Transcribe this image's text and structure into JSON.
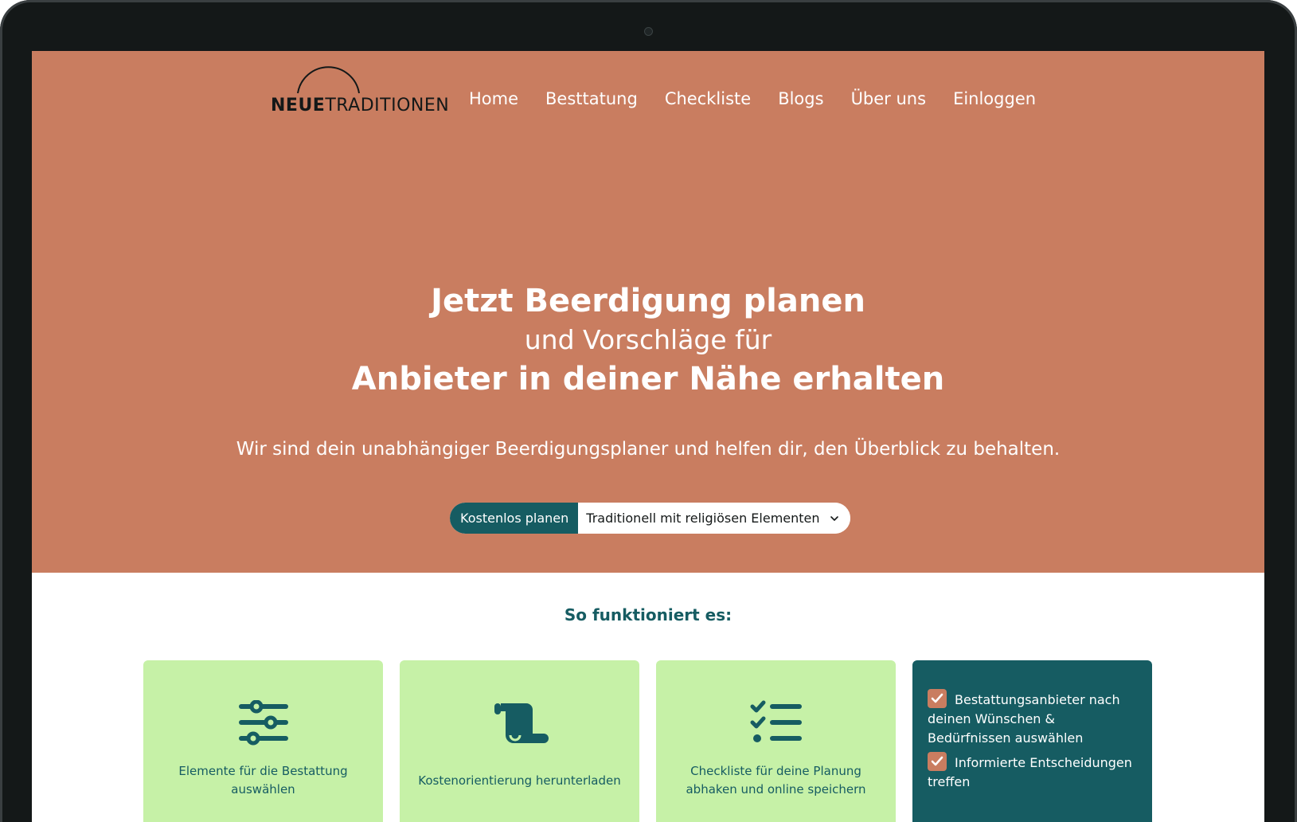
{
  "brand": {
    "name_bold": "NEUE",
    "name_regular": "TRADITIONEN"
  },
  "nav": {
    "items": [
      "Home",
      "Besttatung",
      "Checkliste",
      "Blogs",
      "Über uns",
      "Einloggen"
    ]
  },
  "hero": {
    "line1": "Jetzt Beerdigung planen",
    "line2": "und Vorschläge für",
    "line3": "Anbieter in deiner Nähe erhalten",
    "subline": "Wir sind dein unabhängiger Beerdigungsplaner und helfen dir, den Überblick zu behalten.",
    "cta_label": "Kostenlos planen",
    "select_value": "Traditionell mit religiösen Elementen"
  },
  "how": {
    "title": "So funktioniert es:",
    "cards": [
      {
        "icon": "sliders-icon",
        "label": "Elemente für die Bestattung auswählen"
      },
      {
        "icon": "scroll-icon",
        "label": "Kostenorientierung herunterladen"
      },
      {
        "icon": "checklist-icon",
        "label": "Checkliste für deine Planung abhaken und online speichern"
      }
    ],
    "benefits": [
      "Bestattungsanbieter nach deinen Wünschen & Bedürfnissen auswählen",
      "Informierte Entscheidungen treffen"
    ]
  },
  "colors": {
    "hero_bg": "#c97d60",
    "accent_teal": "#165c62",
    "card_green": "#c6f1a7",
    "bezel": "#141818"
  }
}
